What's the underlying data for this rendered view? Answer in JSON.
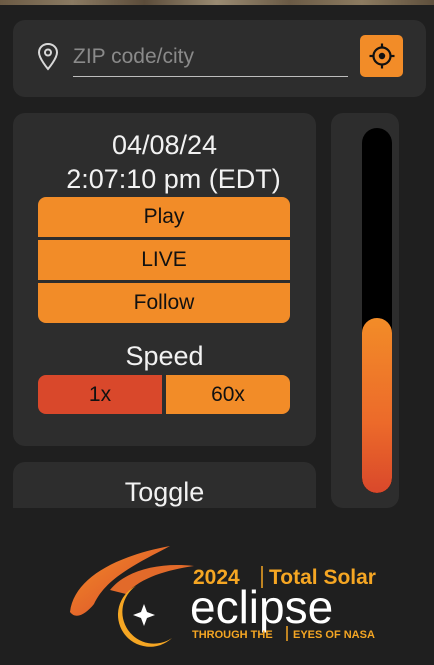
{
  "search": {
    "placeholder": "ZIP code/city",
    "value": ""
  },
  "datetime": {
    "date": "04/08/24",
    "time": "2:07:10 pm (EDT)"
  },
  "controls": {
    "play_label": "Play",
    "live_label": "LIVE",
    "follow_label": "Follow"
  },
  "speed": {
    "label": "Speed",
    "options": [
      "1x",
      "60x"
    ],
    "selected": "1x"
  },
  "toggle": {
    "label": "Toggle"
  },
  "slider": {
    "fill_fraction": 0.48
  },
  "logo": {
    "year": "2024",
    "title_line": "Total Solar",
    "word": "eclipse",
    "tagline_left": "THROUGH THE",
    "tagline_right": "EYES OF NASA"
  },
  "colors": {
    "accent": "#f28c28",
    "active_speed": "#d9482b",
    "panel": "#2d2d2d",
    "background": "#1f1f1f"
  }
}
